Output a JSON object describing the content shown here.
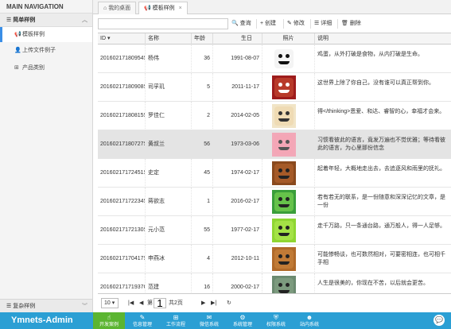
{
  "sidebar": {
    "title": "MAIN NAVIGATION",
    "group": "简单样例",
    "items": [
      {
        "label": "模板样例",
        "active": true
      },
      {
        "label": "上传文件例子"
      },
      {
        "label": "产品类别"
      }
    ],
    "bottom": "复杂样例"
  },
  "tabs": [
    {
      "label": "我的桌面"
    },
    {
      "label": "模板样例",
      "close": "×"
    }
  ],
  "toolbar": {
    "search_placeholder": "",
    "query": "查询",
    "create": "创建",
    "edit": "修改",
    "detail": "详细",
    "delete": "删除"
  },
  "table": {
    "columns": [
      "ID",
      "名称",
      "年龄",
      "生日",
      "照片",
      "说明"
    ],
    "rows": [
      {
        "id": "20160217180954S",
        "name": "杨伟",
        "age": "36",
        "birthday": "1991-08-07",
        "desc": "鸡蛋，从外打破是食物，从内打破是生命。",
        "bg": "#ffffff",
        "face": "#f4f4f4",
        "eye": "#111"
      },
      {
        "id": "20160217180908S",
        "name": "司孚玑",
        "age": "5",
        "birthday": "2011-11-17",
        "desc": "这世界上除了你自己，没有谁可以真正帮到你。",
        "bg": "#9e1c1c",
        "face": "#b83a2a",
        "eye": "#fff"
      },
      {
        "id": "20160217180815S",
        "name": "罗佳仁",
        "age": "2",
        "birthday": "2014-02-05",
        "desc": "得</thinking>恩爱、和达、睿智的心，幸福才会来。",
        "bg": "#f1e4c6",
        "face": "#efdbb4",
        "eye": "#333"
      },
      {
        "id": "20160217180727S",
        "name": "黄叔兰",
        "age": "56",
        "birthday": "1973-03-06",
        "desc": "习惯看彼此的语言，竟发万遍也不觉优雅；等待看彼此的语言，为心里那份信念",
        "bg": "#f2a8b8",
        "face": "#f4a6b6",
        "eye": "#555",
        "selected": true
      },
      {
        "id": "20160217172451S",
        "name": "史定",
        "age": "45",
        "birthday": "1974-02-17",
        "desc": "起着年轻，大概地走出去，去追逐风和雨里的抚礼。",
        "bg": "#8a4a1e",
        "face": "#a55a28",
        "eye": "#222"
      },
      {
        "id": "20160217172234S",
        "name": "蒋欲志",
        "age": "1",
        "birthday": "2016-02-17",
        "desc": "若有若无的联系，是一份随意和深深记忆的文章，是一份",
        "bg": "#3a9e3a",
        "face": "#66c24a",
        "eye": "#222"
      },
      {
        "id": "20160217172130S",
        "name": "元小范",
        "age": "55",
        "birthday": "1977-02-17",
        "desc": "走千万路，只一条通台路，通万般人，得一人足够。",
        "bg": "#8fd632",
        "face": "#a4e246",
        "eye": "#222"
      },
      {
        "id": "20160217170417S",
        "name": "申燕冰",
        "age": "4",
        "birthday": "2012-10-11",
        "desc": "可能惨畅谈，也可数然相对，可要密相连，也可相千手相",
        "bg": "#b06a2a",
        "face": "#c07a36",
        "eye": "#222"
      },
      {
        "id": "20160217171937C",
        "name": "范建",
        "age": "16",
        "birthday": "2000-02-17",
        "desc": "人生是很美的，你现在不苦，以后就会更苦。",
        "bg": "#6b8a70",
        "face": "#7c9a7e",
        "eye": "#222"
      }
    ]
  },
  "pager": {
    "page_size": "10",
    "prefix": "第",
    "page": "1",
    "suffix": "共2页"
  },
  "footer": {
    "brand": "Ymnets-Admin",
    "nav": [
      {
        "label": "开发案例",
        "icon": "☝",
        "active": true
      },
      {
        "label": "信息管理",
        "icon": "✎"
      },
      {
        "label": "工作流程",
        "icon": "⊞"
      },
      {
        "label": "微信系统",
        "icon": "✉"
      },
      {
        "label": "系统管理",
        "icon": "⚙"
      },
      {
        "label": "权限系统",
        "icon": "⛨"
      },
      {
        "label": "站内系统",
        "icon": "☻"
      }
    ]
  },
  "colors": {
    "footer": "#2b9fd4",
    "active_nav": "#5bb531",
    "accent": "#3a8ee6"
  }
}
